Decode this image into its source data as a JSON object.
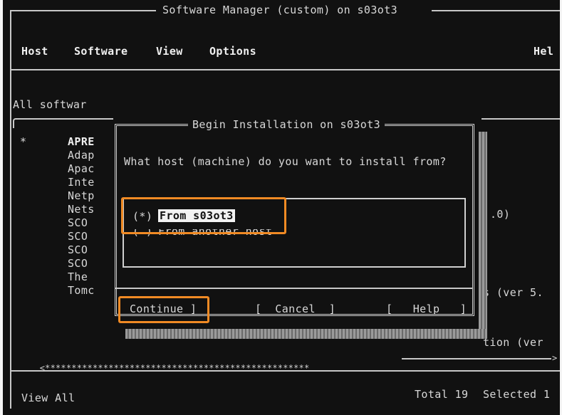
{
  "window": {
    "title": "Software Manager (custom) on s03ot3"
  },
  "menubar": {
    "items": [
      "Host",
      "Software",
      "View",
      "Options"
    ],
    "help": "Hel"
  },
  "list": {
    "header": "All softwar",
    "marker": "*",
    "rows": [
      "APRE",
      "Adap",
      "Apac",
      "Inte",
      "Netp",
      "Nets",
      "SCO",
      "SCO",
      "SCO",
      "SCO",
      "The",
      "Tomc"
    ],
    "right_fragments": {
      "netp": ".0)",
      "sco": "s (ver 5.",
      "tomc": "tion (ver"
    },
    "scroll_left": "<",
    "scroll_stars": "**************************************************",
    "scroll_right": ">"
  },
  "dialog": {
    "title": "Begin Installation on s03ot3",
    "question": "What host (machine) do you want to install from?",
    "options": [
      {
        "mark": "(*)",
        "label": "From s03ot3",
        "selected": true
      },
      {
        "mark": "( )",
        "label": "From another host",
        "selected": false
      }
    ],
    "buttons": {
      "continue": "Continue ]",
      "cancel": "[  Cancel  ]",
      "help": "[   Help   ]"
    }
  },
  "status": {
    "view": "View All",
    "total": "Total 19",
    "selected": "Selected 1"
  },
  "colors": {
    "highlight": "#f08a24",
    "screen": "#111111",
    "text": "#d8d8d8"
  }
}
